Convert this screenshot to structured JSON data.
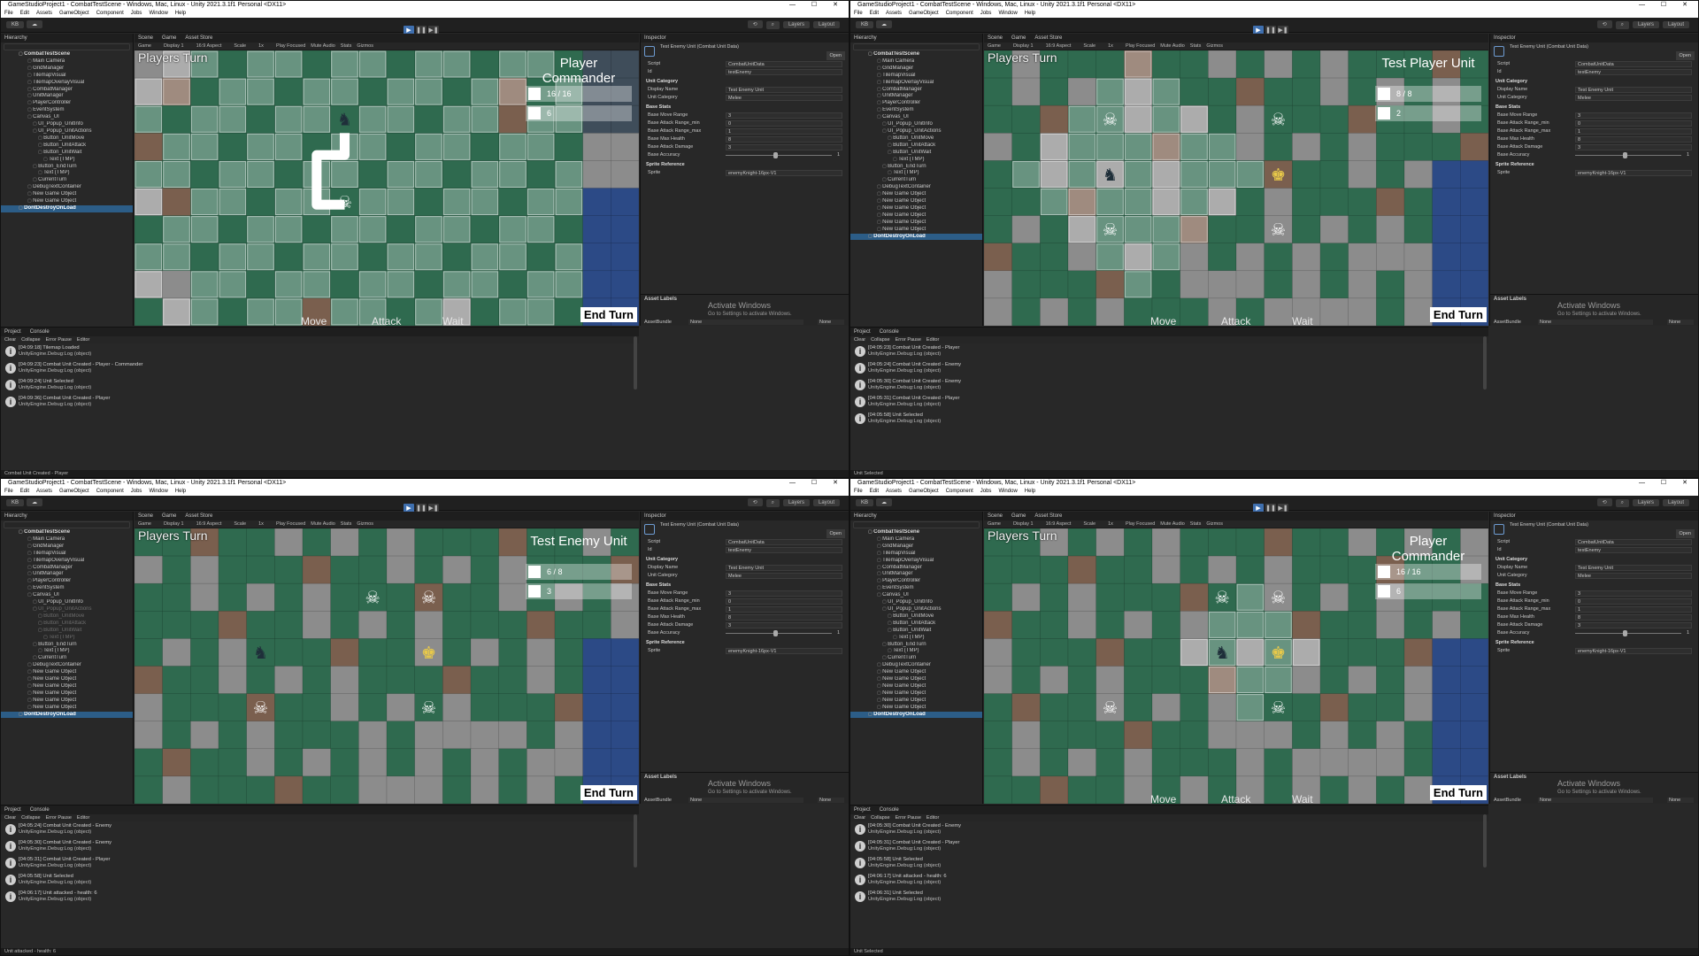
{
  "window_title": "GameStudioProject1 - CombatTestScene - Windows, Mac, Linux - Unity 2021.3.1f1 Personal <DX11>",
  "menu": [
    "File",
    "Edit",
    "Assets",
    "GameObject",
    "Component",
    "Jobs",
    "Window",
    "Help"
  ],
  "toolbar": {
    "account": "KB",
    "layers": "Layers",
    "layout": "Layout"
  },
  "tabs": {
    "hierarchy": "Hierarchy",
    "scene": "Scene",
    "game": "Game",
    "asset_store": "Asset Store",
    "inspector": "Inspector",
    "project": "Project",
    "console": "Console"
  },
  "game_bar": {
    "display_mode": "Game",
    "display": "Display 1",
    "aspect": "16:9 Aspect",
    "scale_label": "Scale",
    "scale_value": "1x",
    "play_focused": "Play Focused",
    "mute": "Mute Audio",
    "stats": "Stats",
    "gizmos": "Gizmos"
  },
  "console_bar": {
    "clear": "Clear",
    "collapse": "Collapse",
    "error_pause": "Error Pause",
    "editor": "Editor"
  },
  "inspector": {
    "title": "Test Enemy Unit (Combat Unit Data)",
    "open": "Open",
    "script_label": "Script",
    "script_value": "CombatUnitData",
    "id_label": "Id",
    "id_value": "testEnemy",
    "unit_category_section": "Unit Category",
    "display_name_label": "Display Name",
    "display_name_value": "Test Enemy Unit",
    "category_label": "Unit Category",
    "category_value": "Melee",
    "base_stats_section": "Base Stats",
    "stats": [
      {
        "label": "Base Move Range",
        "value": "3"
      },
      {
        "label": "Base Attack Range_min",
        "value": "0"
      },
      {
        "label": "Base Attack Range_max",
        "value": "1"
      },
      {
        "label": "Base Max Health",
        "value": "8"
      },
      {
        "label": "Base Attack Damage",
        "value": "3"
      }
    ],
    "accuracy_label": "Base Accuracy",
    "accuracy_value": "1",
    "sprite_section": "Sprite Reference",
    "sprite_label": "Sprite",
    "sprite_value": "enemyKnight-16px-V1",
    "asset_labels": "Asset Labels",
    "assetbundle_label": "AssetBundle",
    "assetbundle_value": "None",
    "assetbundle_variant": "None",
    "activate_title": "Activate Windows",
    "activate_sub": "Go to Settings to activate Windows."
  },
  "hierarchy_scene": "CombatTestScene",
  "panes": [
    {
      "hierarchy": [
        {
          "t": "Main Camera",
          "l": 1
        },
        {
          "t": "GridManager",
          "l": 1
        },
        {
          "t": "TilemapVisual",
          "l": 1
        },
        {
          "t": "TilemapOverlayVisual",
          "l": 1
        },
        {
          "t": "CombatManager",
          "l": 1
        },
        {
          "t": "UnitManager",
          "l": 1
        },
        {
          "t": "PlayerController",
          "l": 1
        },
        {
          "t": "EventSystem",
          "l": 1
        },
        {
          "t": "Canvas_UI",
          "l": 1
        },
        {
          "t": "UI_Popup_UnitInfo",
          "l": 2
        },
        {
          "t": "UI_Popup_UnitActions",
          "l": 2
        },
        {
          "t": "Button_UnitMove",
          "l": 3
        },
        {
          "t": "Button_UnitAttack",
          "l": 3
        },
        {
          "t": "Button_UnitWait",
          "l": 3
        },
        {
          "t": "Text (TMP)",
          "l": 4
        },
        {
          "t": "Button_EndTurn",
          "l": 2
        },
        {
          "t": "Text (TMP)",
          "l": 3
        },
        {
          "t": "CurrentTurn",
          "l": 2
        },
        {
          "t": "DebugTextContainer",
          "l": 1
        },
        {
          "t": "New Game Object",
          "l": 1
        },
        {
          "t": "New Game Object",
          "l": 1
        },
        {
          "t": "DontDestroyOnLoad",
          "l": 0,
          "sel": true
        }
      ],
      "hud": {
        "turn": "Players Turn",
        "name": "Player Commander",
        "stat1": "16 / 16",
        "stat2": "6",
        "end_turn": "End Turn",
        "actions": [
          "Move",
          "Attack",
          "Wait"
        ]
      },
      "logs": [
        {
          "msg": "[04:09:18] Tilemap Loaded",
          "sub": "UnityEngine.Debug:Log (object)"
        },
        {
          "msg": "[04:09:23] Combat Unit Created - Player - Commander",
          "sub": "UnityEngine.Debug:Log (object)"
        },
        {
          "msg": "[04:09:24] Unit Selected",
          "sub": "UnityEngine.Debug:Log (object)"
        },
        {
          "msg": "[04:09:36] Combat Unit Created - Player",
          "sub": "UnityEngine.Debug:Log (object)"
        }
      ],
      "status": "Combat Unit Created - Player"
    },
    {
      "hierarchy": [
        {
          "t": "Main Camera",
          "l": 1
        },
        {
          "t": "GridManager",
          "l": 1
        },
        {
          "t": "TilemapVisual",
          "l": 1
        },
        {
          "t": "TilemapOverlayVisual",
          "l": 1
        },
        {
          "t": "CombatManager",
          "l": 1
        },
        {
          "t": "UnitManager",
          "l": 1
        },
        {
          "t": "PlayerController",
          "l": 1
        },
        {
          "t": "EventSystem",
          "l": 1
        },
        {
          "t": "Canvas_UI",
          "l": 1
        },
        {
          "t": "UI_Popup_UnitInfo",
          "l": 2
        },
        {
          "t": "UI_Popup_UnitActions",
          "l": 2
        },
        {
          "t": "Button_UnitMove",
          "l": 3
        },
        {
          "t": "Button_UnitAttack",
          "l": 3
        },
        {
          "t": "Button_UnitWait",
          "l": 3
        },
        {
          "t": "Text (TMP)",
          "l": 4
        },
        {
          "t": "Button_EndTurn",
          "l": 2
        },
        {
          "t": "Text (TMP)",
          "l": 3
        },
        {
          "t": "CurrentTurn",
          "l": 2
        },
        {
          "t": "DebugTextContainer",
          "l": 1
        },
        {
          "t": "New Game Object",
          "l": 1
        },
        {
          "t": "New Game Object",
          "l": 1
        },
        {
          "t": "New Game Object",
          "l": 1
        },
        {
          "t": "New Game Object",
          "l": 1
        },
        {
          "t": "New Game Object",
          "l": 1
        },
        {
          "t": "New Game Object",
          "l": 1
        },
        {
          "t": "DontDestroyOnLoad",
          "l": 0,
          "sel": true
        }
      ],
      "hud": {
        "turn": "Players Turn",
        "name": "Test Player Unit",
        "stat1": "8 / 8",
        "stat2": "2",
        "end_turn": "End Turn",
        "actions": [
          "Move",
          "Attack",
          "Wait"
        ]
      },
      "logs": [
        {
          "msg": "[04:05:23] Combat Unit Created - Player",
          "sub": "UnityEngine.Debug:Log (object)"
        },
        {
          "msg": "[04:05:24] Combat Unit Created - Enemy",
          "sub": "UnityEngine.Debug:Log (object)"
        },
        {
          "msg": "[04:05:30] Combat Unit Created - Enemy",
          "sub": "UnityEngine.Debug:Log (object)"
        },
        {
          "msg": "[04:05:31] Combat Unit Created - Player",
          "sub": "UnityEngine.Debug:Log (object)"
        },
        {
          "msg": "[04:05:58] Unit Selected",
          "sub": "UnityEngine.Debug:Log (object)"
        }
      ],
      "status": "Unit Selected"
    },
    {
      "hierarchy": [
        {
          "t": "Main Camera",
          "l": 1
        },
        {
          "t": "GridManager",
          "l": 1
        },
        {
          "t": "TilemapVisual",
          "l": 1
        },
        {
          "t": "TilemapOverlayVisual",
          "l": 1
        },
        {
          "t": "CombatManager",
          "l": 1
        },
        {
          "t": "UnitManager",
          "l": 1
        },
        {
          "t": "PlayerController",
          "l": 1
        },
        {
          "t": "EventSystem",
          "l": 1
        },
        {
          "t": "Canvas_UI",
          "l": 1
        },
        {
          "t": "UI_Popup_UnitInfo",
          "l": 2
        },
        {
          "t": "UI_Popup_UnitActions",
          "l": 2,
          "dim": true
        },
        {
          "t": "Button_UnitMove",
          "l": 3,
          "dim": true
        },
        {
          "t": "Button_UnitAttack",
          "l": 3,
          "dim": true
        },
        {
          "t": "Button_UnitWait",
          "l": 3,
          "dim": true
        },
        {
          "t": "Text (TMP)",
          "l": 4,
          "dim": true
        },
        {
          "t": "Button_EndTurn",
          "l": 2
        },
        {
          "t": "Text (TMP)",
          "l": 3
        },
        {
          "t": "CurrentTurn",
          "l": 2
        },
        {
          "t": "DebugTextContainer",
          "l": 1
        },
        {
          "t": "New Game Object",
          "l": 1
        },
        {
          "t": "New Game Object",
          "l": 1
        },
        {
          "t": "New Game Object",
          "l": 1
        },
        {
          "t": "New Game Object",
          "l": 1
        },
        {
          "t": "New Game Object",
          "l": 1
        },
        {
          "t": "New Game Object",
          "l": 1
        },
        {
          "t": "DontDestroyOnLoad",
          "l": 0,
          "sel": true
        }
      ],
      "hud": {
        "turn": "Players Turn",
        "name": "Test Enemy Unit",
        "stat1": "6 / 8",
        "stat2": "3",
        "end_turn": "End Turn",
        "actions": []
      },
      "logs": [
        {
          "msg": "[04:05:24] Combat Unit Created - Enemy",
          "sub": "UnityEngine.Debug:Log (object)"
        },
        {
          "msg": "[04:05:30] Combat Unit Created - Enemy",
          "sub": "UnityEngine.Debug:Log (object)"
        },
        {
          "msg": "[04:05:31] Combat Unit Created - Player",
          "sub": "UnityEngine.Debug:Log (object)"
        },
        {
          "msg": "[04:05:58] Unit Selected",
          "sub": "UnityEngine.Debug:Log (object)"
        },
        {
          "msg": "[04:06:17] Unit attacked - health: 6",
          "sub": "UnityEngine.Debug:Log (object)"
        }
      ],
      "status": "Unit attacked - health: 6"
    },
    {
      "hierarchy": [
        {
          "t": "Main Camera",
          "l": 1
        },
        {
          "t": "GridManager",
          "l": 1
        },
        {
          "t": "TilemapVisual",
          "l": 1
        },
        {
          "t": "TilemapOverlayVisual",
          "l": 1
        },
        {
          "t": "CombatManager",
          "l": 1
        },
        {
          "t": "UnitManager",
          "l": 1
        },
        {
          "t": "PlayerController",
          "l": 1
        },
        {
          "t": "EventSystem",
          "l": 1
        },
        {
          "t": "Canvas_UI",
          "l": 1
        },
        {
          "t": "UI_Popup_UnitInfo",
          "l": 2
        },
        {
          "t": "UI_Popup_UnitActions",
          "l": 2
        },
        {
          "t": "Button_UnitMove",
          "l": 3
        },
        {
          "t": "Button_UnitAttack",
          "l": 3
        },
        {
          "t": "Button_UnitWait",
          "l": 3
        },
        {
          "t": "Text (TMP)",
          "l": 4
        },
        {
          "t": "Button_EndTurn",
          "l": 2
        },
        {
          "t": "Text (TMP)",
          "l": 3
        },
        {
          "t": "CurrentTurn",
          "l": 2
        },
        {
          "t": "DebugTextContainer",
          "l": 1
        },
        {
          "t": "New Game Object",
          "l": 1
        },
        {
          "t": "New Game Object",
          "l": 1
        },
        {
          "t": "New Game Object",
          "l": 1
        },
        {
          "t": "New Game Object",
          "l": 1
        },
        {
          "t": "New Game Object",
          "l": 1
        },
        {
          "t": "New Game Object",
          "l": 1
        },
        {
          "t": "DontDestroyOnLoad",
          "l": 0,
          "sel": true
        }
      ],
      "hud": {
        "turn": "Players Turn",
        "name": "Player Commander",
        "stat1": "16 / 16",
        "stat2": "6",
        "end_turn": "End Turn",
        "actions": [
          "Move",
          "Attack",
          "Wait"
        ]
      },
      "logs": [
        {
          "msg": "[04:05:30] Combat Unit Created - Enemy",
          "sub": "UnityEngine.Debug:Log (object)"
        },
        {
          "msg": "[04:05:31] Combat Unit Created - Player",
          "sub": "UnityEngine.Debug:Log (object)"
        },
        {
          "msg": "[04:05:58] Unit Selected",
          "sub": "UnityEngine.Debug:Log (object)"
        },
        {
          "msg": "[04:06:17] Unit attacked - health: 6",
          "sub": "UnityEngine.Debug:Log (object)"
        },
        {
          "msg": "[04:06:31] Unit Selected",
          "sub": "UnityEngine.Debug:Log (object)"
        }
      ],
      "status": "Unit Selected"
    }
  ],
  "colors": {
    "grass": "#2f6a4f",
    "stone": "#8c8c8c",
    "dirt": "#7a5f4e",
    "water": "#2c4a86",
    "highlight": "#ffffff"
  }
}
